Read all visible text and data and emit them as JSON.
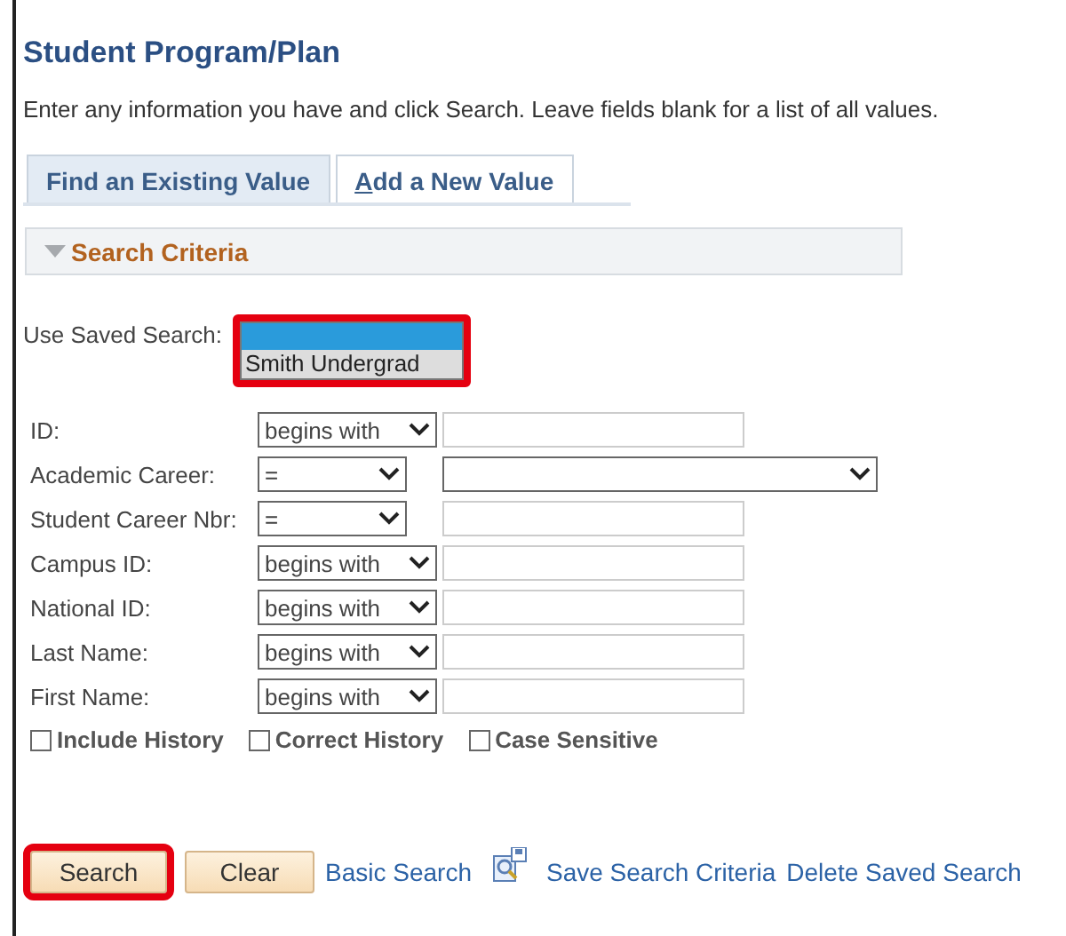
{
  "page": {
    "title": "Student Program/Plan",
    "instructions": "Enter any information you have and click Search. Leave fields blank for a list of all values."
  },
  "tabs": [
    {
      "label": "Find an Existing Value",
      "selected": true,
      "underline_first": false
    },
    {
      "label": "Add a New Value",
      "selected": false,
      "underline_first": true
    }
  ],
  "section": {
    "title": "Search Criteria",
    "expanded": true
  },
  "saved_search": {
    "label": "Use Saved Search:",
    "blank_selected": true,
    "highlighted": true,
    "options": [
      {
        "label": "Smith Undergrad",
        "selected": false
      }
    ]
  },
  "fields": [
    {
      "label": "ID:",
      "operator": "begins with",
      "kind": "text"
    },
    {
      "label": "Academic Career:",
      "operator": "=",
      "kind": "select"
    },
    {
      "label": "Student Career Nbr:",
      "operator": "=",
      "kind": "text"
    },
    {
      "label": "Campus ID:",
      "operator": "begins with",
      "kind": "text"
    },
    {
      "label": "National ID:",
      "operator": "begins with",
      "kind": "text"
    },
    {
      "label": "Last Name:",
      "operator": "begins with",
      "kind": "text"
    },
    {
      "label": "First Name:",
      "operator": "begins with",
      "kind": "text"
    }
  ],
  "options": [
    {
      "label": "Include History",
      "checked": false
    },
    {
      "label": "Correct History",
      "checked": false
    },
    {
      "label": "Case Sensitive",
      "checked": false
    }
  ],
  "buttons": [
    {
      "label": "Search",
      "highlighted": true
    },
    {
      "label": "Clear",
      "highlighted": false
    }
  ],
  "links": [
    {
      "label": "Basic Search",
      "icon": false
    },
    {
      "label": "Save Search Criteria",
      "icon": true
    },
    {
      "label": "Delete Saved Search",
      "icon": false
    }
  ]
}
